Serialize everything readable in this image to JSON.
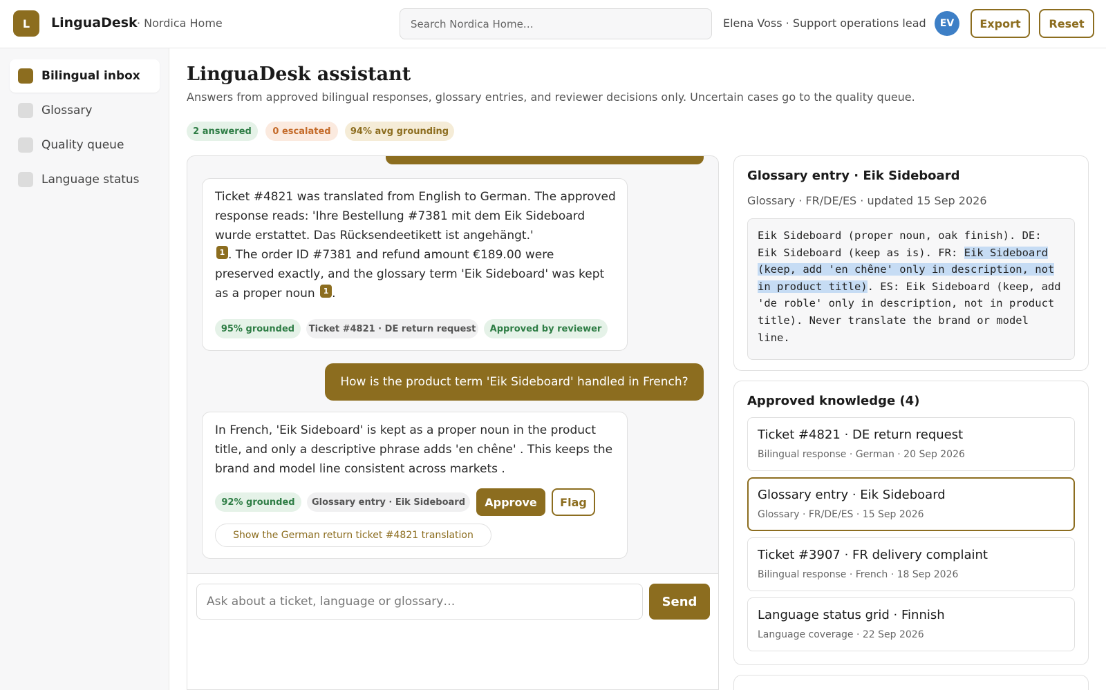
{
  "header": {
    "logo_letter": "L",
    "brand": "LinguaDesk",
    "workspace": "· Nordica Home",
    "search_placeholder": "Search Nordica Home…",
    "user": "Elena Voss · Support operations lead",
    "avatar_initials": "EV",
    "export_label": "Export",
    "reset_label": "Reset"
  },
  "sidebar": {
    "items": [
      {
        "label": "Bilingual inbox",
        "active": true
      },
      {
        "label": "Glossary",
        "active": false
      },
      {
        "label": "Quality queue",
        "active": false
      },
      {
        "label": "Language status",
        "active": false
      }
    ]
  },
  "main": {
    "title": "LinguaDesk assistant",
    "subtitle": "Answers from approved bilingual responses, glossary entries, and reviewer decisions only. Uncertain cases go to the quality queue.",
    "stats": [
      "2 answered",
      "0 escalated",
      "94% avg grounding"
    ]
  },
  "chat": {
    "messages": [
      {
        "role": "assistant",
        "text_1": "Ticket #4821 was translated from English to German. The approved response reads: 'Ihre Bestellung #7381 mit dem Eik Sideboard wurde erstattet. Das Rücksendeetikett ist angehängt.'",
        "cite_1": "1",
        "text_2": ". The order ID #7381 and refund amount €189.00 were preserved exactly, and the glossary term 'Eik Sideboard' was kept as a proper noun",
        "cite_2": "1",
        "text_3": ".",
        "grounding": "95% grounded",
        "source": "Ticket #4821 · DE return request",
        "status": "Approved by reviewer"
      },
      {
        "role": "user",
        "text": "How is the product term 'Eik Sideboard' handled in French?"
      },
      {
        "role": "assistant",
        "text": "In French, 'Eik Sideboard' is kept as a proper noun in the product title, and only a descriptive phrase adds 'en chêne' . This keeps the brand and model line consistent across markets .",
        "grounding": "92% grounded",
        "source": "Glossary entry · Eik Sideboard",
        "approve_label": "Approve",
        "flag_label": "Flag",
        "suggestion": "Show the German return ticket #4821 translation"
      }
    ],
    "input_placeholder": "Ask about a ticket, language or glossary…",
    "send_label": "Send"
  },
  "source_panel": {
    "title": "Glossary entry · Eik Sideboard",
    "meta": "Glossary · FR/DE/ES · updated 15 Sep 2026",
    "excerpt_before": "Eik Sideboard (proper noun, oak finish). DE: Eik Sideboard (keep as is). FR: ",
    "excerpt_highlight": "Eik Sideboard (keep, add 'en chêne' only in description, not in product title)",
    "excerpt_after": ". ES: Eik Sideboard (keep, add 'de roble' only in description, not in product title). Never translate the brand or model line."
  },
  "knowledge": {
    "title": "Approved knowledge (4)",
    "items": [
      {
        "title": "Ticket #4821 · DE return request",
        "meta": "Bilingual response · German · 20 Sep 2026",
        "selected": false
      },
      {
        "title": "Glossary entry · Eik Sideboard",
        "meta": "Glossary · FR/DE/ES · 15 Sep 2026",
        "selected": true
      },
      {
        "title": "Ticket #3907 · FR delivery complaint",
        "meta": "Bilingual response · French · 18 Sep 2026",
        "selected": false
      },
      {
        "title": "Language status grid · Finnish",
        "meta": "Language coverage · 22 Sep 2026",
        "selected": false
      }
    ]
  },
  "colors": {
    "accent": "#8c6d1f",
    "avatar": "#3d7fc6",
    "green": "#2e7d45",
    "orange": "#c46b2a",
    "highlight": "#c6dcf4"
  }
}
